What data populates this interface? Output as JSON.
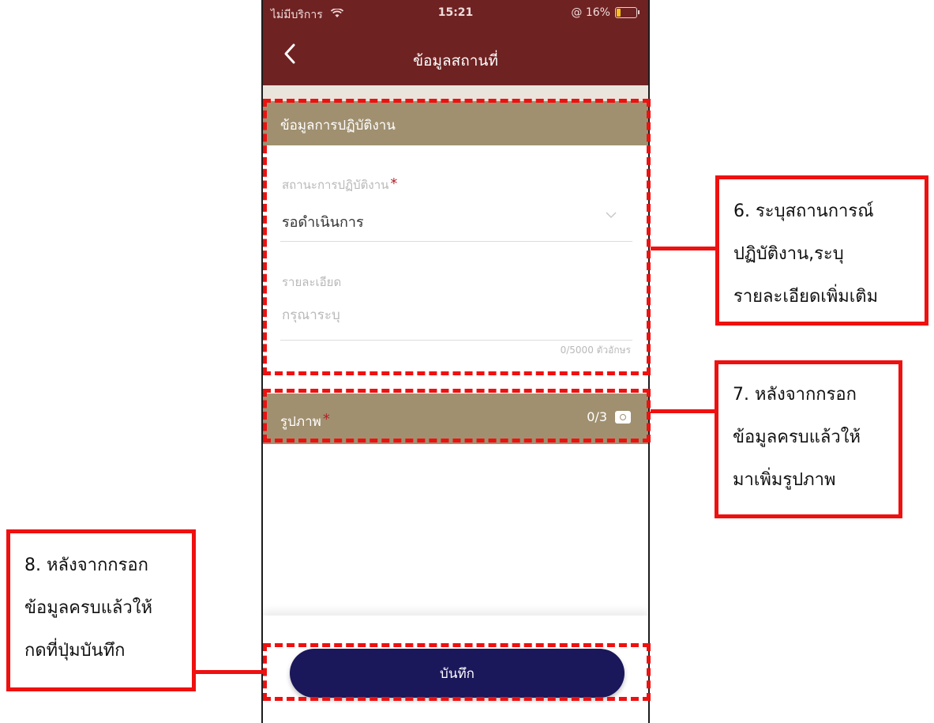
{
  "status_bar": {
    "carrier": "ไม่มีบริการ",
    "wifi_icon": "wifi-icon",
    "time": "15:21",
    "battery": "@ 16%",
    "battery_level_percent": 16
  },
  "nav": {
    "back_icon": "chevron-left-icon",
    "title": "ข้อมูลสถานที่"
  },
  "section_operation": {
    "header": "ข้อมูลการปฏิบัติงาน",
    "status_label": "สถานะการปฏิบัติงาน",
    "required_mark": "*",
    "status_value": "รอดำเนินการ",
    "details_label": "รายละเอียด",
    "details_placeholder": "กรุณาระบุ",
    "details_value": "",
    "char_counter": "0/5000 ตัวอักษร"
  },
  "section_photo": {
    "header": "รูปภาพ",
    "required_mark": "*",
    "count": "0/3",
    "camera_icon": "camera-icon"
  },
  "footer": {
    "save_label": "บันทึก"
  },
  "callouts": {
    "c6": [
      "6. ระบุสถานการณ์",
      "ปฏิบัติงาน,ระบุ",
      "รายละเอียดเพิ่มเติม"
    ],
    "c7": [
      "7. หลังจากกรอก",
      "ข้อมูลครบแล้วให้",
      "มาเพิ่มรูปภาพ"
    ],
    "c8": [
      "8. หลังจากกรอก",
      "ข้อมูลครบแล้วให้",
      "กดที่ปุ่มบันทึก"
    ]
  },
  "colors": {
    "header_bar": "#6f2222",
    "section_header": "#a09070",
    "save_button": "#1a175a",
    "highlight": "#ef1010",
    "required": "#b3202a"
  }
}
